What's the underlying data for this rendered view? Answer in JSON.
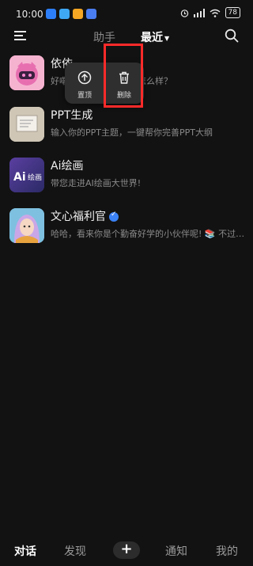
{
  "status_bar": {
    "time": "10:00",
    "battery": "78"
  },
  "header": {
    "tabs": [
      {
        "label": "助手"
      },
      {
        "label": "最近"
      }
    ]
  },
  "chats": [
    {
      "name": "依依",
      "preview": "好嘞…条怎么样？一条怎么样？",
      "avatar": "yiyi-avatar"
    },
    {
      "name": "PPT生成",
      "preview": "输入你的PPT主题，一键帮你完善PPT大纲",
      "avatar": "ppt-avatar"
    },
    {
      "name": "Ai绘画",
      "preview": "带您走进AI绘画大世界!",
      "avatar": "ai-painting-avatar"
    },
    {
      "name": "文心福利官",
      "preview": "哈哈，看来你是个勤奋好学的小伙伴呢! 📚 不过…",
      "avatar": "welfare-avatar",
      "verified": true
    }
  ],
  "context_menu": {
    "pin_label": "置顶",
    "delete_label": "删除"
  },
  "bottom_nav": {
    "chat": "对话",
    "discover": "发现",
    "add": "+",
    "notify": "通知",
    "mine": "我的"
  },
  "colors": {
    "background": "#121212",
    "highlight": "#ff2a2a",
    "verified": "#3b82f6"
  }
}
